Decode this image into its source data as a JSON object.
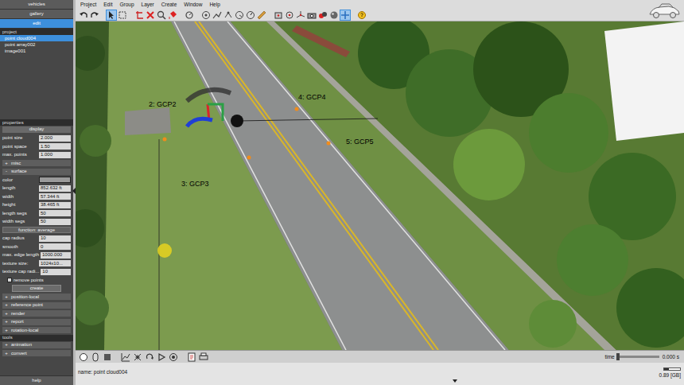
{
  "menu": [
    "Project",
    "Edit",
    "Group",
    "Layer",
    "Create",
    "Window",
    "Help"
  ],
  "sidebar": {
    "tabs": [
      {
        "label": "vehicles",
        "selected": false
      },
      {
        "label": "gallery",
        "selected": false
      },
      {
        "label": "edit",
        "selected": true
      }
    ],
    "project": {
      "title": "project",
      "items": [
        {
          "label": "point cloud004",
          "selected": true
        },
        {
          "label": "point array002",
          "selected": false
        },
        {
          "label": "image001",
          "selected": false
        }
      ]
    },
    "properties": {
      "title": "properties",
      "rows": [
        {
          "kind": "header",
          "label": "display"
        },
        {
          "kind": "field",
          "label": "point size",
          "value": "2.000"
        },
        {
          "kind": "field",
          "label": "point space",
          "value": "1.50"
        },
        {
          "kind": "field",
          "label": "max. points",
          "value": "1.000"
        },
        {
          "kind": "group",
          "icon": "+",
          "label": "misc",
          "expanded": false
        },
        {
          "kind": "group",
          "icon": "-",
          "label": "surface",
          "expanded": true
        },
        {
          "kind": "color",
          "label": "color",
          "color": "#9a9a9a"
        },
        {
          "kind": "field",
          "label": "length",
          "value": "852.632 ft"
        },
        {
          "kind": "field",
          "label": "width",
          "value": "57.344 ft"
        },
        {
          "kind": "field",
          "label": "height",
          "value": "38.465 ft"
        },
        {
          "kind": "field",
          "label": "length segs",
          "value": "50"
        },
        {
          "kind": "field",
          "label": "width segs",
          "value": "50"
        },
        {
          "kind": "select",
          "label": "function: average"
        },
        {
          "kind": "field",
          "label": "cap radius",
          "value": "10"
        },
        {
          "kind": "field",
          "label": "smooth",
          "value": "0"
        },
        {
          "kind": "field",
          "label": "max. edge length",
          "value": "1000.000"
        },
        {
          "kind": "field",
          "label": "texture size:",
          "value": "1024x10..."
        },
        {
          "kind": "field",
          "label": "texture cap radi...",
          "value": "10"
        },
        {
          "kind": "check",
          "label": "remove points",
          "checked": false
        },
        {
          "kind": "button",
          "label": "create"
        },
        {
          "kind": "group",
          "icon": "+",
          "label": "position-local",
          "expanded": false
        },
        {
          "kind": "group",
          "icon": "+",
          "label": "reference point",
          "expanded": false
        },
        {
          "kind": "group",
          "icon": "+",
          "label": "render",
          "expanded": false
        },
        {
          "kind": "group",
          "icon": "+",
          "label": "report",
          "expanded": false
        },
        {
          "kind": "group",
          "icon": "+",
          "label": "rotation-local",
          "expanded": false
        }
      ]
    },
    "tools": {
      "title": "tools",
      "rows": [
        {
          "kind": "group",
          "icon": "+",
          "label": "animation",
          "expanded": false
        },
        {
          "kind": "group",
          "icon": "+",
          "label": "convert",
          "expanded": false
        }
      ]
    },
    "help": "help"
  },
  "viewport": {
    "markers": [
      {
        "label": "2: GCP2"
      },
      {
        "label": "4: GCP4"
      },
      {
        "label": "5: GCP5"
      },
      {
        "label": "3: GCP3"
      }
    ]
  },
  "timeline": {
    "label": "time",
    "reading": "0.000 s",
    "level": 0
  },
  "status": {
    "name": "name: point cloud004",
    "memory": "0.89 [GB]",
    "memory_level": 0.3
  }
}
